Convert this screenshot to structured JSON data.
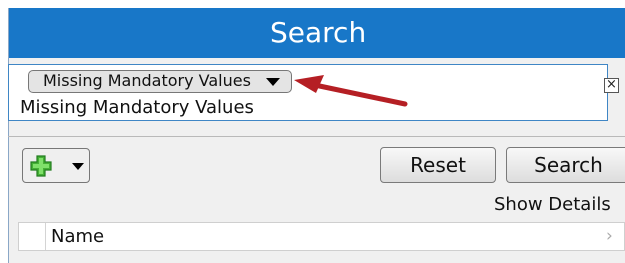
{
  "header": {
    "title": "Search"
  },
  "criteria": {
    "selected_type": "Missing Mandatory Values",
    "value": "Missing Mandatory Values",
    "close_label": "×"
  },
  "toolbar": {
    "add_icon": "plus-icon",
    "reset_label": "Reset",
    "search_label": "Search"
  },
  "details": {
    "link_label": "Show Details"
  },
  "results": {
    "columns": [
      "Name"
    ],
    "expand_glyph": "›"
  },
  "colors": {
    "title_bar": "#1877c8",
    "panel": "#f0f0f0",
    "annotation_arrow": "#b51f24",
    "add_icon": "#45b035"
  }
}
